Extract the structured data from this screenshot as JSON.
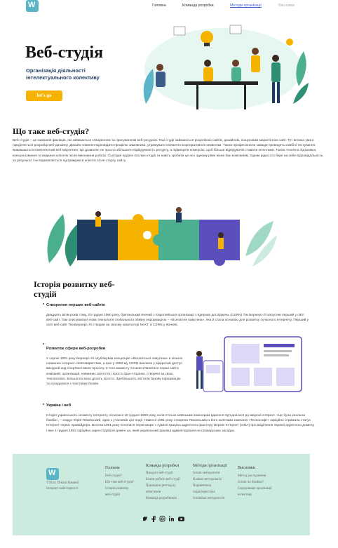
{
  "header": {
    "logo_letter": "W",
    "logo_sub": "web",
    "nav": [
      {
        "label": "Головна"
      },
      {
        "label": "Команда розробки"
      },
      {
        "label": "Методи організації"
      },
      {
        "label": "Висновки"
      }
    ]
  },
  "hero": {
    "title": "Веб-студія",
    "subtitle": "Організація діяльності інтелектуального колективу",
    "button": "let's go"
  },
  "about": {
    "title": "Що таке веб-студія?",
    "text": "Веб-студія – це компанія фахівців, які займаються створенням та просуванням веб-ресурсів. Такі студії займаються розробкою сайтів, дизайном, пошуковим маркетінгом сайт. Тут велика увага приділяється розробці веб-дизайну. Дизайн повинен відповідати профілю замовника, утримувати елементи корпоративної символіки. Також професіонали завжди проводять комбіні тестування. Виважаються комплексний веб-маркетинг. Це дозволяє не просто збільшити відвідуваність ресурсу, а підвищити комерсію, щоб більше відвідувачів ставали клієнтами. Також технічна підтримка, консультування та ведення клієнтів після виконання роботи. Сьогодні надати послуги студії та навіть зробити це на і одному рівні може бан компаніям. Однак рідко хто бере на себе відповідальність за результат і не відмовляється підтримувати клієнта після старту сайту."
  },
  "history": {
    "title": "Історія розвитку веб-студій",
    "items": [
      {
        "title": "Створення перших веб-сайтів",
        "text": "Двадцять вісім років тому, 20 грудня 1990 року, британський вчений з Європейської організації з ядерних досліджень (CERN) Тім Бернерс-Лі запустив перший у світі веб-сайт. Там описувалася нова технологія глобального обміну інформацією – «Всесвітня павутина», яка й стала основою для розвитку сучасного Інтернету. Перший у світі веб-сайт Тім Бернерс-Лі створив на своєму комп'ютері NeXT, в CERN у Женеві."
      },
      {
        "title": "Розвиток сфери веб-розробки",
        "text": "У серпні 1991 року Бернерс-Лі опублікував концепцію «Всесвітньої павутини» в кількох новинних інтернет-співтовариствах, а вже у 1993-му CERN виклала у відкритий доступ вихідний код гіпертекстового проєкту. З того моменту почали з'являтися перші сайти компаній, організацій, новинних агентств і просто фан-сторінок, створені за свою технологією. Більшістю вона досить просто. Здебільшого, містили базову інформацію та складалися з текстових блоків."
      },
      {
        "title": "Україна і веб",
        "text": "Історія українського сегменту Інтернету почалася 19 грудня 1990 року, коли п'ятьох київським інженерам вдалося під'єднатися до мережі Інтернет. «Це була реальна бомба», – згадує Юрій Янковський, один з учасників цієї події. Навесні 1991 року створена Янковським з його колегами компанія «Технософт» офіційно отримала статус Інтернет-сервіс провайдера. Восени 1991 року почалися переговори з Адміністрацією адресного простору мережі Інтернет (IANA) про виділення Україні адресного домену. і вже 1 грудня 1992 офіційно зареєстрували домен ua, який український фахівці адміністрували на громадських засадах."
      }
    ]
  },
  "footer": {
    "copyright": "©2024, Шкала Команії інтернет майстерності",
    "columns": [
      {
        "title": "Головна",
        "items": [
          "Веб-студія?",
          "Що таке веб-студія?",
          "Історія розвитку",
          "веб-студій"
        ]
      },
      {
        "title": "Команда розробки",
        "items": [
          "Продукт веб-студії",
          "Етапи роботи веб-студії",
          "Принципи розподілу",
          "обов`язків",
          "Команда розробників"
        ]
      },
      {
        "title": "Методи організації",
        "items": [
          "Scrum методологія",
          "Kanban методологія",
          "Порівняльна",
          "характеристика",
          "Scrumban методологія"
        ]
      },
      {
        "title": "Висновки",
        "items": [
          "Метод дослідження",
          "Scrum чи Kanban?",
          "Середовище організації",
          "колективу"
        ]
      }
    ],
    "social": [
      "twitter-icon",
      "facebook-icon",
      "instagram-icon",
      "linkedin-icon",
      "youtube-icon"
    ]
  },
  "colors": {
    "accent_yellow": "#f5b300",
    "brand_teal": "#5ab6c7",
    "footer_bg": "#ccebdf",
    "link_active": "#3b5bd6"
  }
}
